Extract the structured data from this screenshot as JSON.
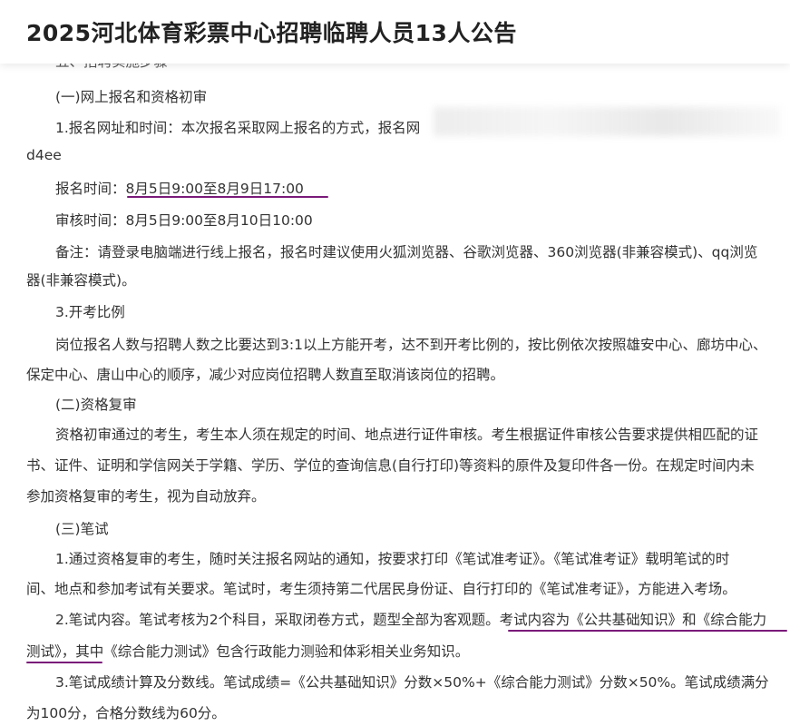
{
  "article": {
    "title": "2025河北体育彩票中心招聘临聘人员13人公告",
    "lines": [
      "五、招聘实施步骤",
      "(一)网上报名和资格初审",
      "1.报名网址和时间：本次报名采取网上报名的方式，报名网",
      "d4ee",
      "报名时间：8月5日9:00至8月9日17:00",
      "审核时间：8月5日9:00至8月10日10:00",
      "备注：请登录电脑端进行线上报名，报名时建议使用火狐浏览器、谷歌浏览器、360浏览器(非兼容模式)、qq浏览",
      "器(非兼容模式)。",
      "3.开考比例",
      "岗位报名人数与招聘人数之比要达到3:1以上方能开考，达不到开考比例的，按比例依次按照雄安中心、廊坊中心、",
      "保定中心、唐山中心的顺序，减少对应岗位招聘人数直至取消该岗位的招聘。",
      "(二)资格复审",
      "资格初审通过的考生，考生本人须在规定的时间、地点进行证件审核。考生根据证件审核公告要求提供相匹配的证",
      "书、证件、证明和学信网关于学籍、学历、学位的查询信息(自行打印)等资料的原件及复印件各一份。在规定时间内未",
      "参加资格复审的考生，视为自动放弃。",
      "(三)笔试",
      "1.通过资格复审的考生，随时关注报名网站的通知，按要求打印《笔试准考证》。《笔试准考证》载明笔试的时",
      "间、地点和参加考试有关要求。笔试时，考生须持第二代居民身份证、自行打印的《笔试准考证》，方能进入考场。",
      "2.笔试内容。笔试考核为2个科目，采取闭卷方式，题型全部为客观题。考试内容为《公共基础知识》和《综合能力",
      "测试》，其中《综合能力测试》包含行政能力测验和体彩相关业务知识。",
      "3.笔试成绩计算及分数线。笔试成绩=《公共基础知识》分数×50%+《综合能力测试》分数×50%。笔试成绩满分",
      "为100分，合格分数线为60分。"
    ]
  },
  "colors": {
    "text": "#333333",
    "title": "#222222",
    "underline": "#7a1a7a"
  }
}
